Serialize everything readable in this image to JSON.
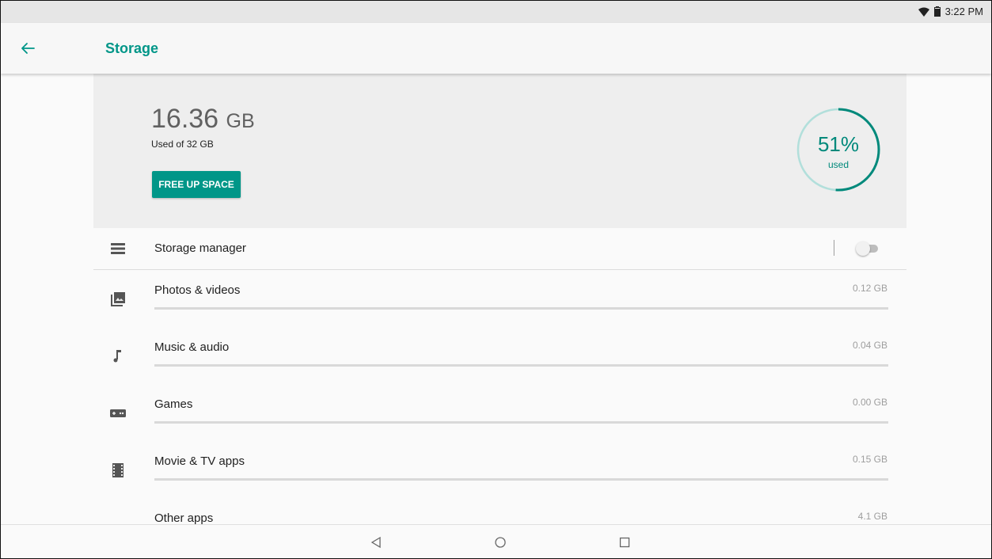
{
  "status_bar": {
    "time": "3:22 PM",
    "icons": [
      "wifi-icon",
      "battery-icon"
    ]
  },
  "app_bar": {
    "title": "Storage",
    "back_icon": "arrow-back-icon"
  },
  "summary": {
    "used_value": "16.36",
    "used_unit": "GB",
    "used_of": "Used of 32 GB",
    "free_up_label": "FREE UP SPACE",
    "gauge_percent_text": "51%",
    "gauge_label": "used",
    "gauge_fraction": 0.51
  },
  "storage_manager": {
    "label": "Storage manager",
    "icon": "storage-list-icon",
    "toggle_on": false
  },
  "categories": [
    {
      "label": "Photos & videos",
      "size": "0.12 GB",
      "icon": "photo-icon",
      "fraction": 0
    },
    {
      "label": "Music & audio",
      "size": "0.04 GB",
      "icon": "music-note-icon",
      "fraction": 0
    },
    {
      "label": "Games",
      "size": "0.00 GB",
      "icon": "gamepad-icon",
      "fraction": 0
    },
    {
      "label": "Movie & TV apps",
      "size": "0.15 GB",
      "icon": "film-icon",
      "fraction": 0
    },
    {
      "label": "Other apps",
      "size": "4.1 GB",
      "icon": "more-horiz-icon",
      "fraction": 0
    }
  ],
  "nav_bar": {
    "icons": [
      "nav-back-icon",
      "nav-home-icon",
      "nav-recents-icon"
    ]
  },
  "colors": {
    "accent": "#009688",
    "summary_bg": "#eeeeee",
    "status_bar_bg": "#e6e6e6"
  }
}
